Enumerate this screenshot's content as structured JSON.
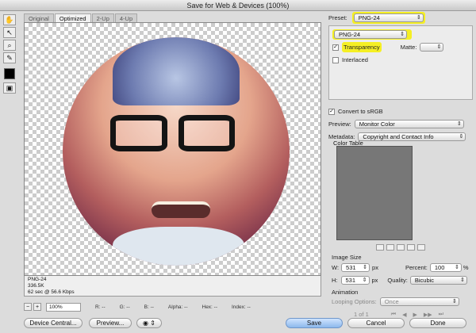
{
  "title": "Save for Web & Devices (100%)",
  "tabs": [
    "Original",
    "Optimized",
    "2-Up",
    "4-Up"
  ],
  "canvas": {
    "info": [
      "PNG-24",
      "336.5K",
      "62 sec @ 56.6 Kbps"
    ],
    "zoom": "100%",
    "readouts": [
      "R: --",
      "G: --",
      "B: --",
      "Alpha: --",
      "Hex: --",
      "Index: --"
    ]
  },
  "right": {
    "preset_label": "Preset:",
    "preset_value": "PNG-24",
    "format_value": "PNG-24",
    "transparency_label": "Transparency",
    "matte_label": "Matte:",
    "interlaced_label": "Interlaced",
    "convert_label": "Convert to sRGB",
    "preview_label": "Preview:",
    "preview_value": "Monitor Color",
    "metadata_label": "Metadata:",
    "metadata_value": "Copyright and Contact Info",
    "color_table_label": "Color Table",
    "image_size_label": "Image Size",
    "w_label": "W:",
    "w_value": "531",
    "h_label": "H:",
    "h_value": "531",
    "px": "px",
    "percent_label": "Percent:",
    "percent_value": "100",
    "percent_unit": "%",
    "quality_label": "Quality:",
    "quality_value": "Bicubic",
    "animation_label": "Animation",
    "looping_label": "Looping Options:",
    "looping_value": "Once",
    "frame_label": "1 of 1"
  },
  "buttons": {
    "device_central": "Device Central...",
    "preview": "Preview...",
    "save": "Save",
    "cancel": "Cancel",
    "done": "Done"
  }
}
